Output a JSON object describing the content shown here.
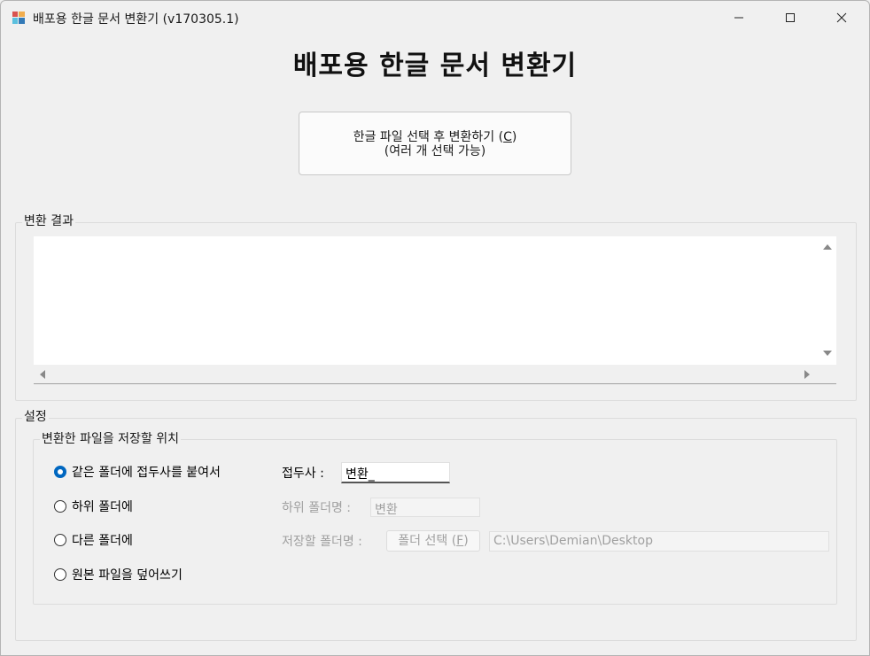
{
  "window": {
    "title": "배포용 한글 문서 변환기 (v170305.1)"
  },
  "main": {
    "title": "배포용 한글 문서 변환기",
    "convert_button": {
      "line1_prefix": "한글 파일 선택 후 변환하기 (",
      "line1_hotkey": "C",
      "line1_suffix": ")",
      "line2": "(여러 개 선택 가능)"
    }
  },
  "result": {
    "group_label": "변환 결과",
    "content": ""
  },
  "settings": {
    "group_label": "설정",
    "location_label": "변환한 파일을 저장할 위치",
    "options": [
      {
        "label": "같은 폴더에 접두사를 붙여서",
        "checked": true
      },
      {
        "label": "하위 폴더에",
        "checked": false
      },
      {
        "label": "다른 폴더에",
        "checked": false
      },
      {
        "label": "원본 파일을 덮어쓰기",
        "checked": false
      }
    ],
    "prefix_label": "접두사 :",
    "prefix_value": "변환_",
    "subfolder_label": "하위 폴더명 :",
    "subfolder_value": "변환",
    "save_folder_label": "저장할 폴더명 :",
    "folder_button": {
      "prefix": "폴더 선택 (",
      "hotkey": "F",
      "suffix": ")"
    },
    "folder_path": "C:\\Users\\Demian\\Desktop"
  }
}
